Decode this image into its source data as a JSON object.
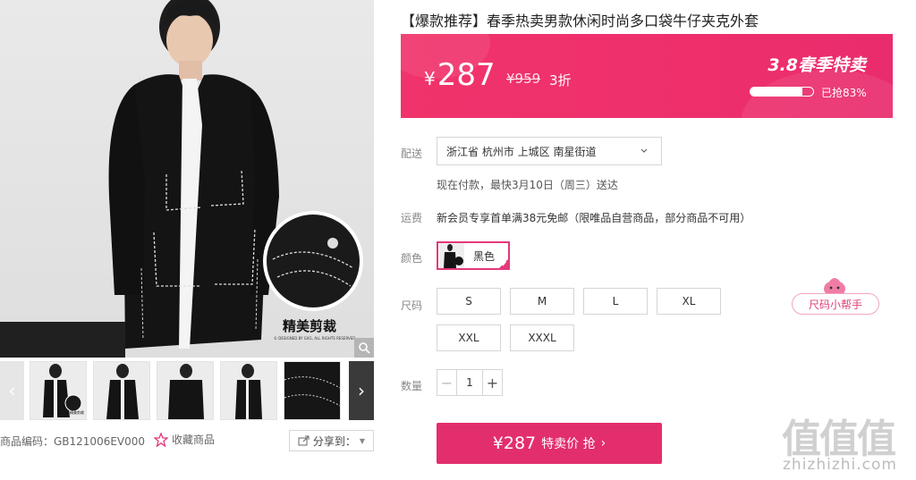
{
  "gallery": {
    "main_caption": "精美剪裁",
    "main_fine_print": "© DESIGNED BY GXG, ALL RIGHTS RESERVED.",
    "thumbnails": [
      "jacket-front",
      "jacket-front-2",
      "jacket-back",
      "jacket-side",
      "jacket-detail"
    ],
    "thumb_caption": "精美剪裁",
    "product_code": "商品编码：GB121006EV000",
    "favorite_label": "收藏商品",
    "share_label": "分享到："
  },
  "product": {
    "title": "【爆款推荐】春季热卖男款休闲时尚多口袋牛仔夹克外套"
  },
  "price_banner": {
    "yen": "¥",
    "price": "287",
    "original_price": "¥959",
    "discount": "3折",
    "promo": "3.8春季特卖",
    "sold_percent": 83,
    "sold_text": "已抢83%",
    "bg_color": "#ee2f6c"
  },
  "delivery": {
    "label": "配送",
    "address": "浙江省 杭州市 上城区 南星街道",
    "note": "现在付款，最快3月10日（周三）送达"
  },
  "shipping": {
    "label": "运费",
    "text": "新会员专享首单满38元免邮（限唯品自营商品，部分商品不可用）"
  },
  "color": {
    "label": "颜色",
    "selected": "黑色",
    "accent": "#e4387b"
  },
  "size": {
    "label": "尺码",
    "options": [
      "S",
      "M",
      "L",
      "XL",
      "XXL",
      "XXXL"
    ],
    "helper": "尺码小帮手"
  },
  "quantity": {
    "label": "数量",
    "value": "1"
  },
  "buy": {
    "price": "¥287",
    "label": "特卖价 抢",
    "color": "#e32e6d"
  },
  "watermark": {
    "big": "值值值",
    "small": "zhizhizhi.com"
  }
}
